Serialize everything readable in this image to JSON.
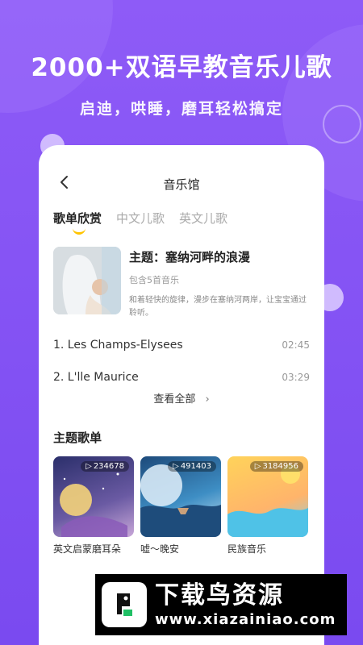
{
  "hero": {
    "title": "2000+双语早教音乐儿歌",
    "subtitle": "启迪，哄睡，磨耳轻松搞定"
  },
  "page": {
    "title": "音乐馆",
    "tabs": [
      "歌单欣赏",
      "中文儿歌",
      "英文儿歌"
    ],
    "active_tab_index": 0
  },
  "theme": {
    "title": "主题：塞纳河畔的浪漫",
    "count": "包含5首音乐",
    "desc": "和着轻快的旋律，漫步在塞纳河两岸，让宝宝通过聆听。"
  },
  "songs": [
    {
      "title": "1. Les Champs-Elysees",
      "duration": "02:45"
    },
    {
      "title": "2. L'lle Maurice",
      "duration": "03:29"
    }
  ],
  "view_all": "查看全部",
  "section_title": "主题歌单",
  "playlists": [
    {
      "name": "英文启蒙磨耳朵",
      "plays": "234678"
    },
    {
      "name": "嘘～晚安",
      "plays": "491403"
    },
    {
      "name": "民族音乐",
      "plays": "3184956"
    }
  ],
  "watermark": {
    "cn": "下载鸟资源",
    "url": "www.xiazainiao.com"
  },
  "colors": {
    "accent": "#FFC400",
    "bg_purple": "#7A4AF0"
  }
}
